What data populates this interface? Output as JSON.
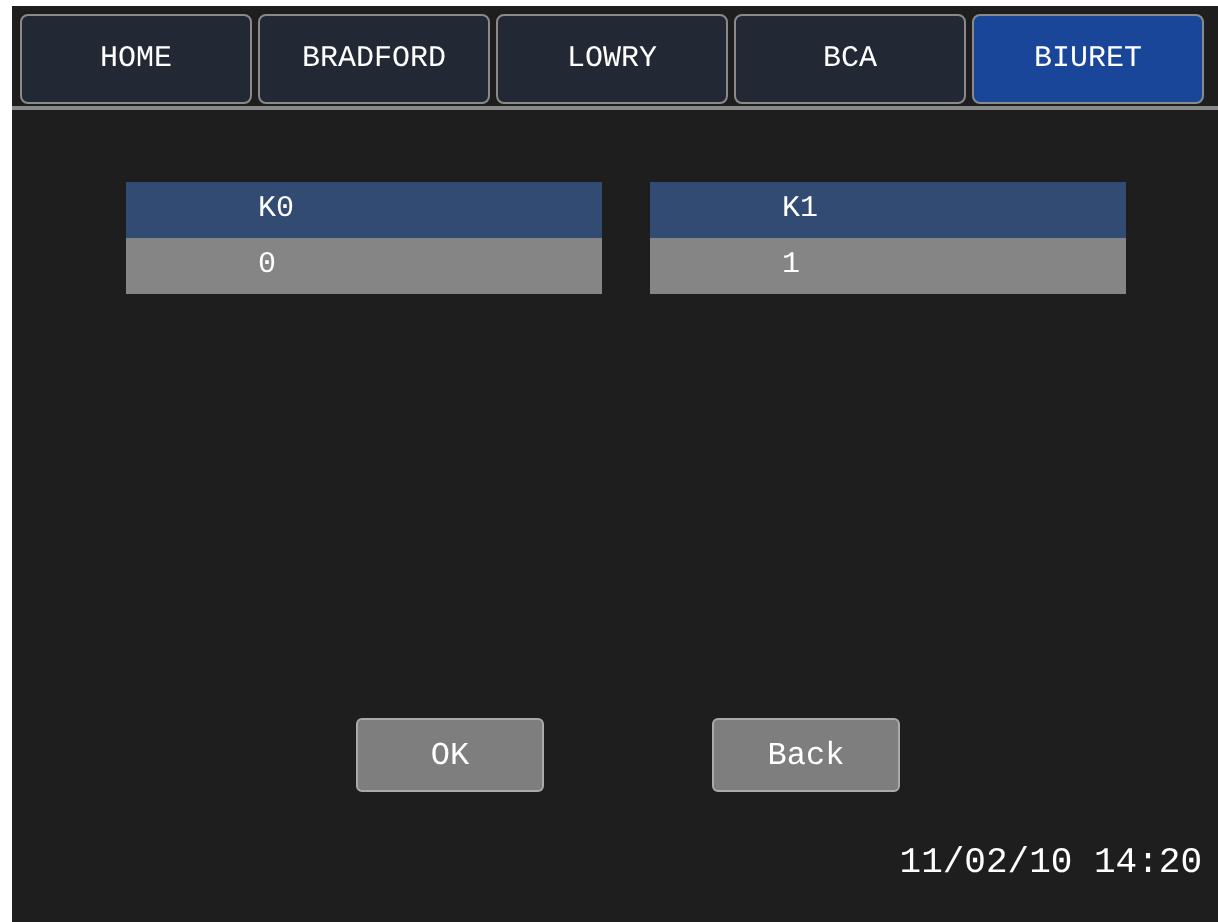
{
  "tabs": [
    {
      "label": "HOME",
      "selected": false
    },
    {
      "label": "BRADFORD",
      "selected": false
    },
    {
      "label": "LOWRY",
      "selected": false
    },
    {
      "label": "BCA",
      "selected": false
    },
    {
      "label": "BIURET",
      "selected": true
    }
  ],
  "fields": [
    {
      "label": "K0",
      "value": "0"
    },
    {
      "label": "K1",
      "value": "1"
    }
  ],
  "buttons": [
    "OK",
    "Back"
  ],
  "status_bar": {
    "datetime": "11/02/10 14:20"
  }
}
